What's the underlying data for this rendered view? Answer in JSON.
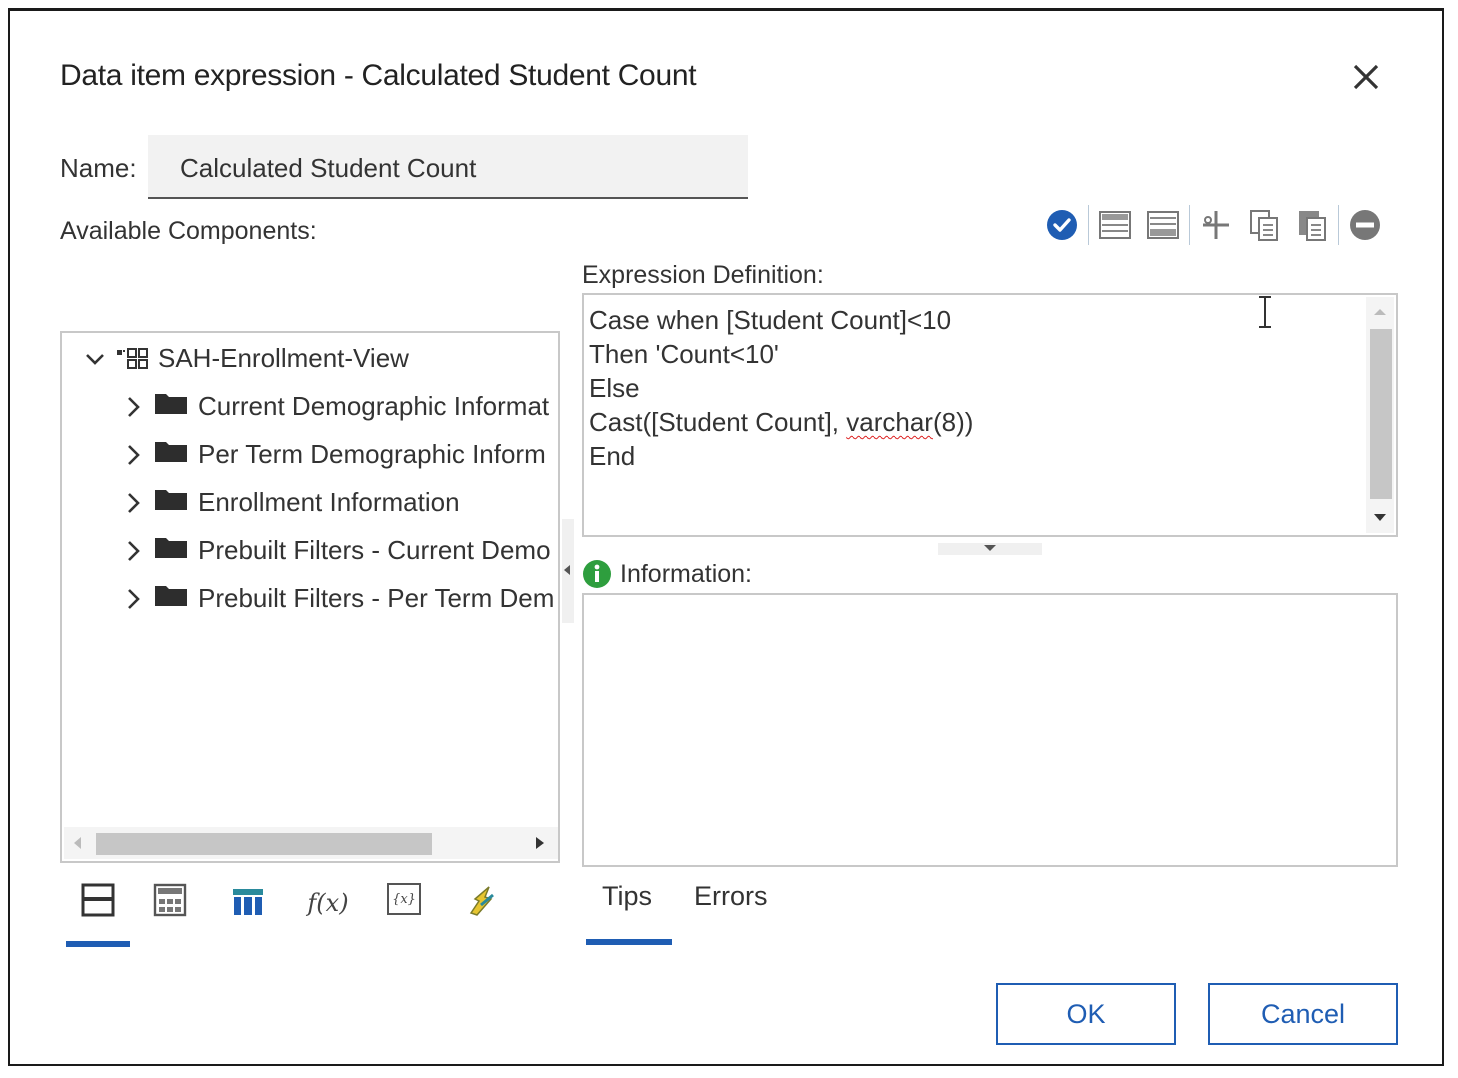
{
  "dialog": {
    "title": "Data item expression - Calculated Student Count",
    "close_label": "✕"
  },
  "name_field": {
    "label": "Name:",
    "value": "Calculated Student Count"
  },
  "available_components": {
    "label": "Available Components:",
    "tree": {
      "root": "SAH-Enrollment-View",
      "items": [
        "Current Demographic Informat",
        "Per Term Demographic Inform",
        "Enrollment Information",
        "Prebuilt Filters - Current Demo",
        "Prebuilt Filters - Per Term Dem"
      ]
    },
    "bottom_tabs": [
      "source-tab-icon",
      "data-items-tab-icon",
      "query-tab-icon",
      "functions-tab-icon",
      "parameters-tab-icon",
      "macros-tab-icon"
    ],
    "bottom_tab_fx": "f(x)",
    "bottom_tab_param": "{x}"
  },
  "toolbar": {
    "icons": [
      "validate-icon",
      "insert-above-icon",
      "insert-below-icon",
      "cut-icon",
      "copy-icon",
      "paste-icon",
      "remove-icon"
    ]
  },
  "expression": {
    "label": "Expression Definition:",
    "lines": {
      "l1": "Case when [Student Count]<10",
      "l2": "Then 'Count<10'",
      "l3": "Else",
      "l4a": "Cast([Student Count], ",
      "l4b": "varchar",
      "l4c": "(8))",
      "l5": "End"
    }
  },
  "information": {
    "label": "Information:"
  },
  "tabs": {
    "tips": "Tips",
    "errors": "Errors"
  },
  "buttons": {
    "ok": "OK",
    "cancel": "Cancel"
  },
  "colors": {
    "accent": "#1f5db3",
    "info_green": "#2e9e3e"
  }
}
